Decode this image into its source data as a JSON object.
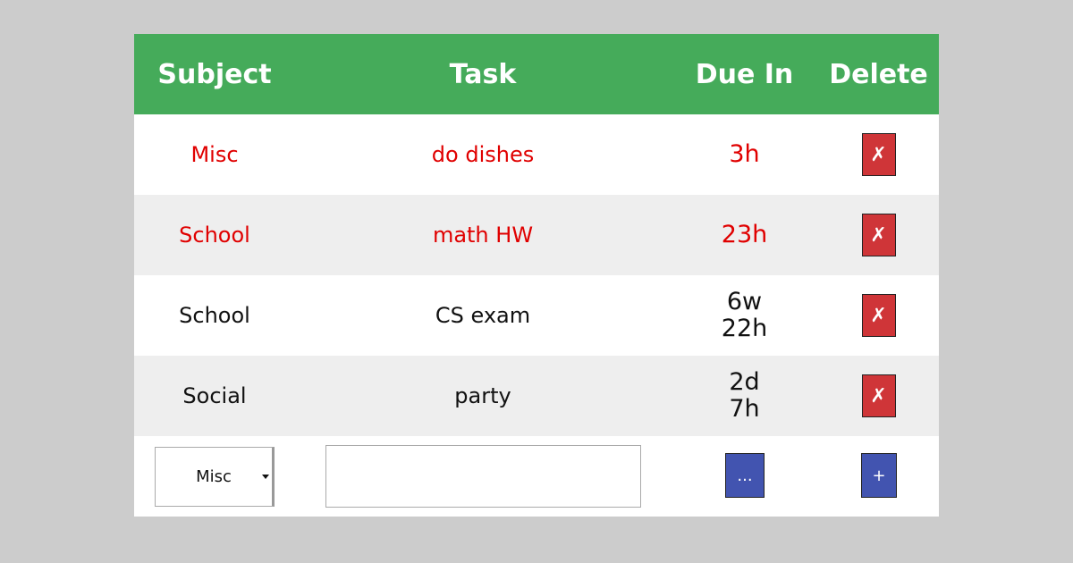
{
  "colors": {
    "background": "#cccccc",
    "header": "#45ab5a",
    "overdue_text": "#e00000",
    "normal_text": "#111111",
    "delete_button": "#cf3538",
    "action_button": "#4254b0",
    "row_alt": "#eeeeee"
  },
  "header": {
    "subject": "Subject",
    "task": "Task",
    "due_in": "Due In",
    "delete": "Delete"
  },
  "rows": [
    {
      "subject": "Misc",
      "task": "do dishes",
      "due_line1": "3h",
      "due_line2": "",
      "delete_label": "✗",
      "urgent": true
    },
    {
      "subject": "School",
      "task": "math HW",
      "due_line1": "23h",
      "due_line2": "",
      "delete_label": "✗",
      "urgent": true
    },
    {
      "subject": "School",
      "task": "CS exam",
      "due_line1": "6w",
      "due_line2": "22h",
      "delete_label": "✗",
      "urgent": false
    },
    {
      "subject": "Social",
      "task": "party",
      "due_line1": "2d",
      "due_line2": "7h",
      "delete_label": "✗",
      "urgent": false
    }
  ],
  "new_row": {
    "subject_selected": "Misc",
    "task_value": "",
    "task_placeholder": "",
    "date_button_label": "...",
    "add_button_label": "+"
  }
}
